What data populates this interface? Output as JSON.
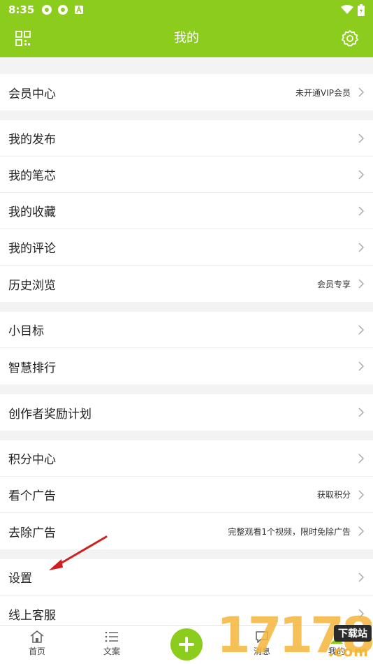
{
  "status_bar": {
    "time": "8:35"
  },
  "header": {
    "title": "我的"
  },
  "groups": [
    {
      "items": [
        {
          "label": "会员中心",
          "hint": "未开通VIP会员"
        }
      ]
    },
    {
      "items": [
        {
          "label": "我的发布",
          "hint": ""
        },
        {
          "label": "我的笔芯",
          "hint": ""
        },
        {
          "label": "我的收藏",
          "hint": ""
        },
        {
          "label": "我的评论",
          "hint": ""
        },
        {
          "label": "历史浏览",
          "hint": "会员专享"
        }
      ]
    },
    {
      "items": [
        {
          "label": "小目标",
          "hint": ""
        },
        {
          "label": "智慧排行",
          "hint": ""
        }
      ]
    },
    {
      "items": [
        {
          "label": "创作者奖励计划",
          "hint": ""
        }
      ]
    },
    {
      "items": [
        {
          "label": "积分中心",
          "hint": ""
        },
        {
          "label": "看个广告",
          "hint": "获取积分"
        },
        {
          "label": "去除广告",
          "hint": "完整观看1个视频，限时免除广告"
        }
      ]
    },
    {
      "items": [
        {
          "label": "设置",
          "hint": ""
        },
        {
          "label": "线上客服",
          "hint": ""
        }
      ]
    }
  ],
  "tabbar": {
    "home": "首页",
    "wenan": "文案",
    "msg": "消息",
    "me": "我的"
  },
  "watermark": {
    "digits": "17178",
    "badge": "下载站",
    "com": ".com"
  },
  "colors": {
    "brand": "#8ccc1d",
    "background": "#f3f3f3",
    "arrow": "#d01f1f"
  }
}
